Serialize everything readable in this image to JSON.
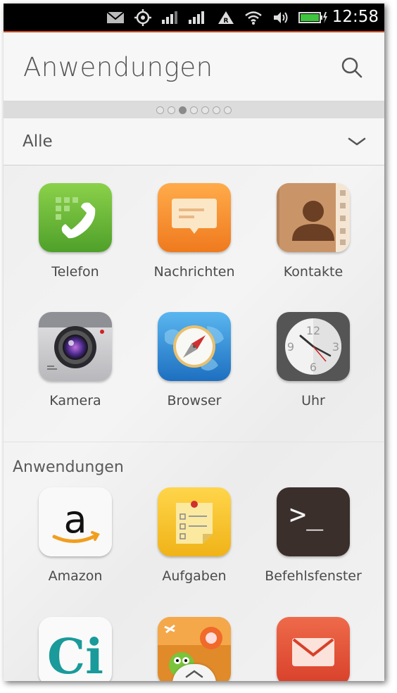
{
  "status_bar": {
    "time": "12:58",
    "icons": [
      "mail-icon",
      "location-icon",
      "signal-icon",
      "signal-icon",
      "roaming-icon",
      "wifi-icon",
      "volume-icon",
      "battery-charging-icon"
    ],
    "accent_color": "#dd4814"
  },
  "header": {
    "title": "Anwendungen",
    "search_icon": "search-icon"
  },
  "pager": {
    "pages": 7,
    "active_index": 2
  },
  "filter": {
    "selected": "Alle",
    "chevron_icon": "chevron-down-icon"
  },
  "favorites": [
    {
      "label": "Telefon",
      "icon": "phone-icon"
    },
    {
      "label": "Nachrichten",
      "icon": "messages-icon"
    },
    {
      "label": "Kontakte",
      "icon": "contacts-icon"
    },
    {
      "label": "Kamera",
      "icon": "camera-icon"
    },
    {
      "label": "Browser",
      "icon": "browser-icon"
    },
    {
      "label": "Uhr",
      "icon": "clock-icon"
    }
  ],
  "apps_section": {
    "title": "Anwendungen",
    "apps": [
      {
        "label": "Amazon",
        "icon": "amazon-icon"
      },
      {
        "label": "Aufgaben",
        "icon": "tasks-icon"
      },
      {
        "label": "Befehlsfenster",
        "icon": "terminal-icon"
      },
      {
        "label": "",
        "icon": "ci-icon"
      },
      {
        "label": "",
        "icon": "cut-the-rope-icon"
      },
      {
        "label": "",
        "icon": "mail-app-icon"
      }
    ]
  },
  "icon_text": {
    "amazon_letter": "a",
    "ci_text": "Ci",
    "terminal_prompt": ">_",
    "clock_12": "12",
    "clock_3": "3",
    "clock_6": "6",
    "clock_9": "9"
  },
  "bottom_handle_icon": "chevron-up-icon"
}
